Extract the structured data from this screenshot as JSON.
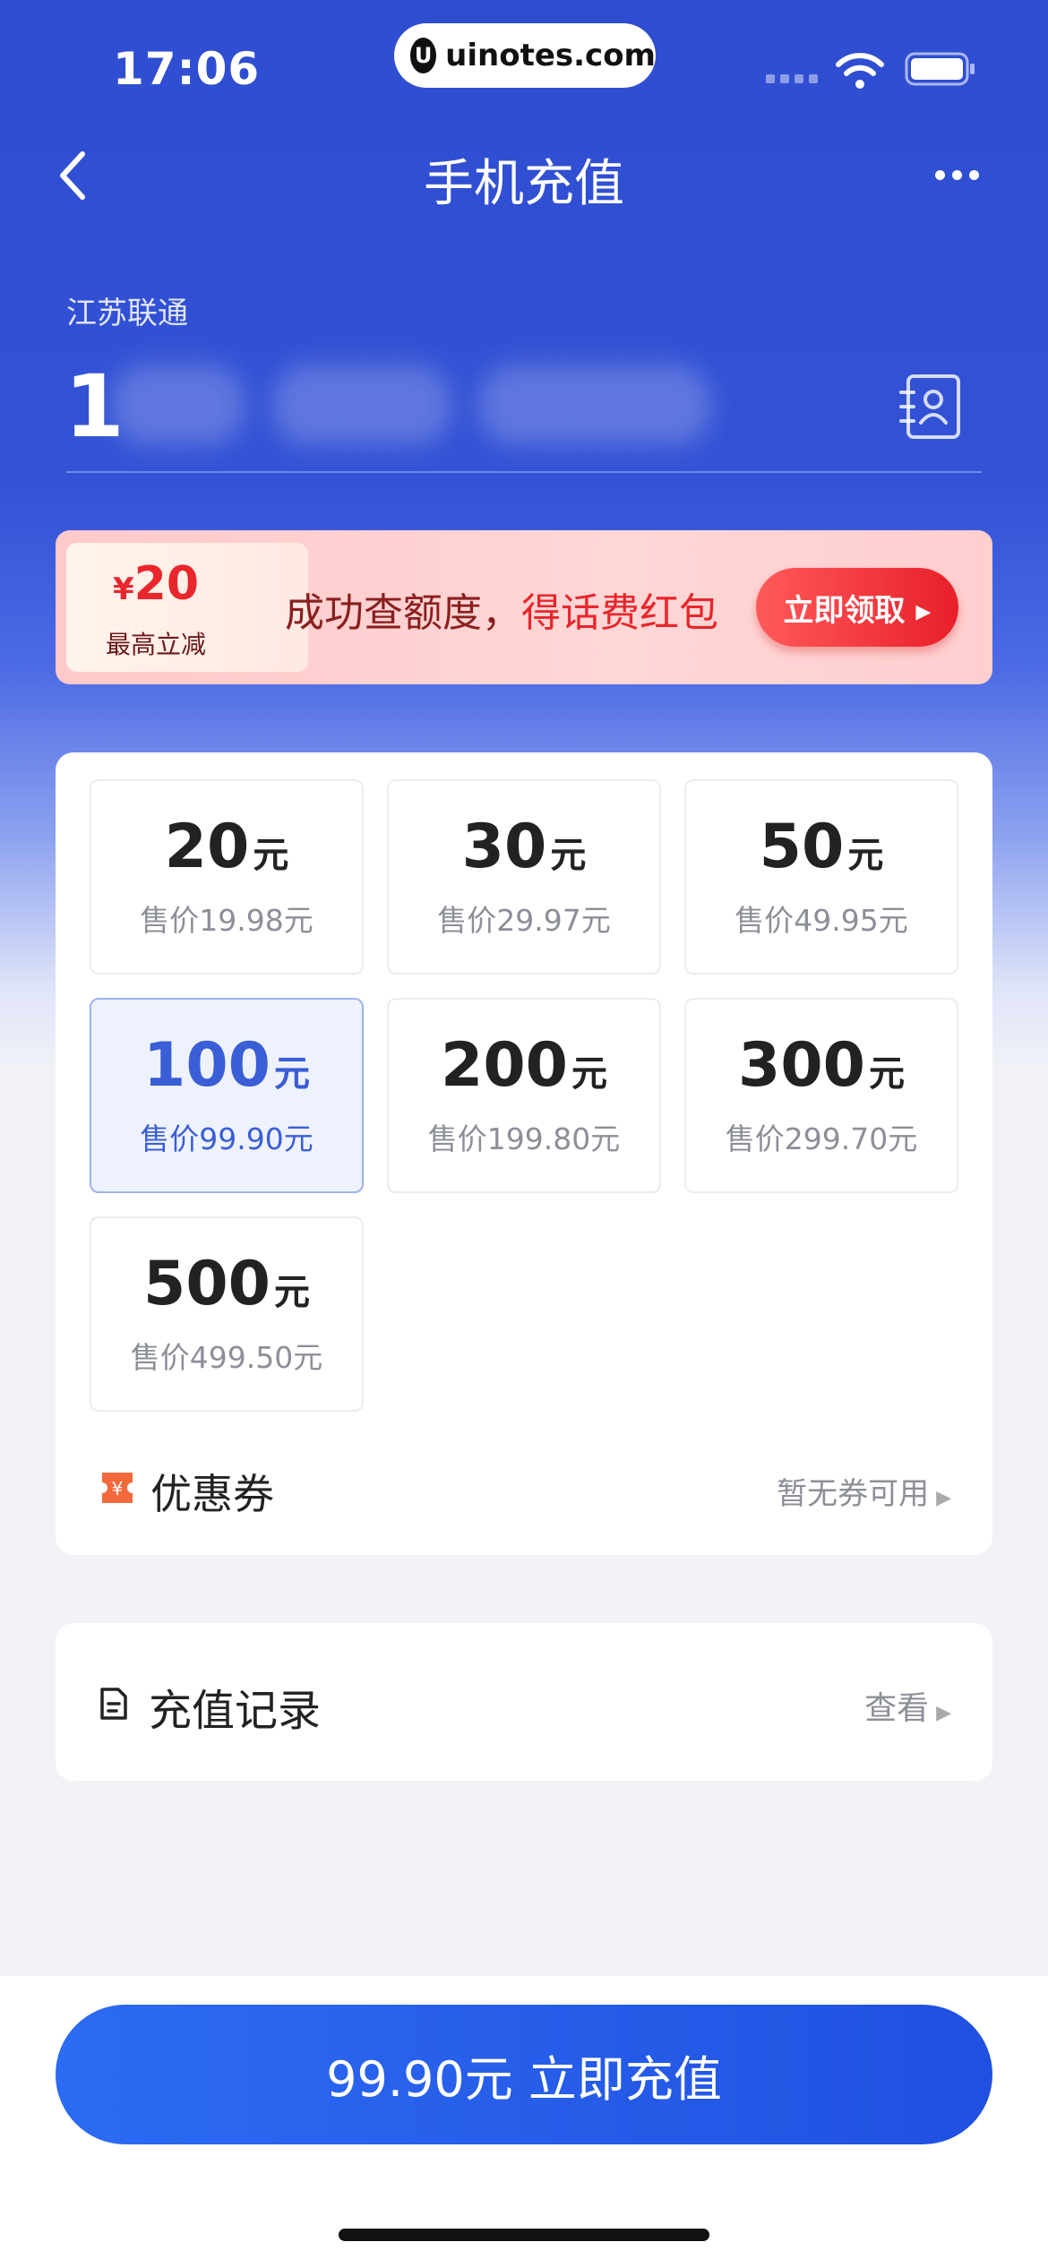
{
  "status_bar": {
    "time": "17:06",
    "url_host": "uinotes.com",
    "logo_letter": "U"
  },
  "nav": {
    "title": "手机充值"
  },
  "account": {
    "carrier": "江苏联通",
    "phone_visible_digit": "1"
  },
  "promo": {
    "amount_symbol": "¥",
    "amount": "20",
    "amount_caption": "最高立减",
    "text_plain": "成功查额度，",
    "text_highlight": "得话费红包",
    "button_label": "立即领取 ▸"
  },
  "options": [
    {
      "face": "20",
      "unit": "元",
      "price": "售价19.98元",
      "selected": false
    },
    {
      "face": "30",
      "unit": "元",
      "price": "售价29.97元",
      "selected": false
    },
    {
      "face": "50",
      "unit": "元",
      "price": "售价49.95元",
      "selected": false
    },
    {
      "face": "100",
      "unit": "元",
      "price": "售价99.90元",
      "selected": true
    },
    {
      "face": "200",
      "unit": "元",
      "price": "售价199.80元",
      "selected": false
    },
    {
      "face": "300",
      "unit": "元",
      "price": "售价299.70元",
      "selected": false
    },
    {
      "face": "500",
      "unit": "元",
      "price": "售价499.50元",
      "selected": false
    }
  ],
  "coupon": {
    "label": "优惠券",
    "status": "暂无券可用"
  },
  "record": {
    "label": "充值记录",
    "action": "查看"
  },
  "pay_button": {
    "label": "99.90元 立即充值"
  },
  "colors": {
    "primary": "#2f4dd1",
    "accent_red": "#e8262c",
    "selected_blue": "#3a5ed6"
  }
}
